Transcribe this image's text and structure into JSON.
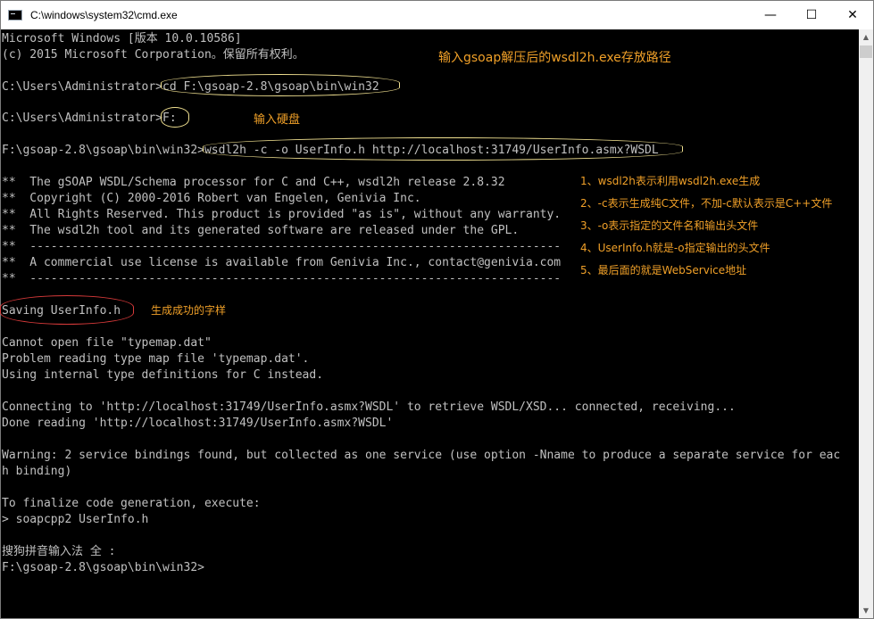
{
  "window": {
    "title": "C:\\windows\\system32\\cmd.exe",
    "controls": {
      "minimize": "—",
      "maximize": "☐",
      "close": "✕"
    }
  },
  "console": {
    "lines": [
      "Microsoft Windows [版本 10.0.10586]",
      "(c) 2015 Microsoft Corporation。保留所有权利。",
      "C:\\Users\\Administrator>cd F:\\gsoap-2.8\\gsoap\\bin\\win32",
      "C:\\Users\\Administrator>F:",
      "F:\\gsoap-2.8\\gsoap\\bin\\win32>wsdl2h -c -o UserInfo.h http://localhost:31749/UserInfo.asmx?WSDL",
      "**  The gSOAP WSDL/Schema processor for C and C++, wsdl2h release 2.8.32",
      "**  Copyright (C) 2000-2016 Robert van Engelen, Genivia Inc.",
      "**  All Rights Reserved. This product is provided \"as is\", without any warranty.",
      "**  The wsdl2h tool and its generated software are released under the GPL.",
      "**  ----------------------------------------------------------------------------",
      "**  A commercial use license is available from Genivia Inc., contact@genivia.com",
      "**  ----------------------------------------------------------------------------",
      "Saving UserInfo.h",
      "Cannot open file \"typemap.dat\"",
      "Problem reading type map file 'typemap.dat'.",
      "Using internal type definitions for C instead.",
      "Connecting to 'http://localhost:31749/UserInfo.asmx?WSDL' to retrieve WSDL/XSD... connected, receiving...",
      "Done reading 'http://localhost:31749/UserInfo.asmx?WSDL'",
      "Warning: 2 service bindings found, but collected as one service (use option -Nname to produce a separate service for eac",
      "h binding)",
      "To finalize code generation, execute:",
      "> soapcpp2 UserInfo.h",
      "搜狗拼音输入法 全 :",
      "F:\\gsoap-2.8\\gsoap\\bin\\win32>"
    ]
  },
  "annotations": {
    "path_note": "输入gsoap解压后的wsdl2h.exe存放路径",
    "drive_note": "输入硬盘",
    "success_note": "生成成功的字样",
    "explain": [
      "1、wsdl2h表示利用wsdl2h.exe生成",
      "2、-c表示生成纯C文件，不加-c默认表示是C++文件",
      "3、-o表示指定的文件名和输出头文件",
      "4、UserInfo.h就是-o指定输出的头文件",
      "5、最后面的就是WebService地址"
    ]
  },
  "colors": {
    "console_bg": "#000000",
    "console_text": "#c0c0c0",
    "annotation": "#f0a028",
    "highlight_ellipse": "#f0e090"
  }
}
